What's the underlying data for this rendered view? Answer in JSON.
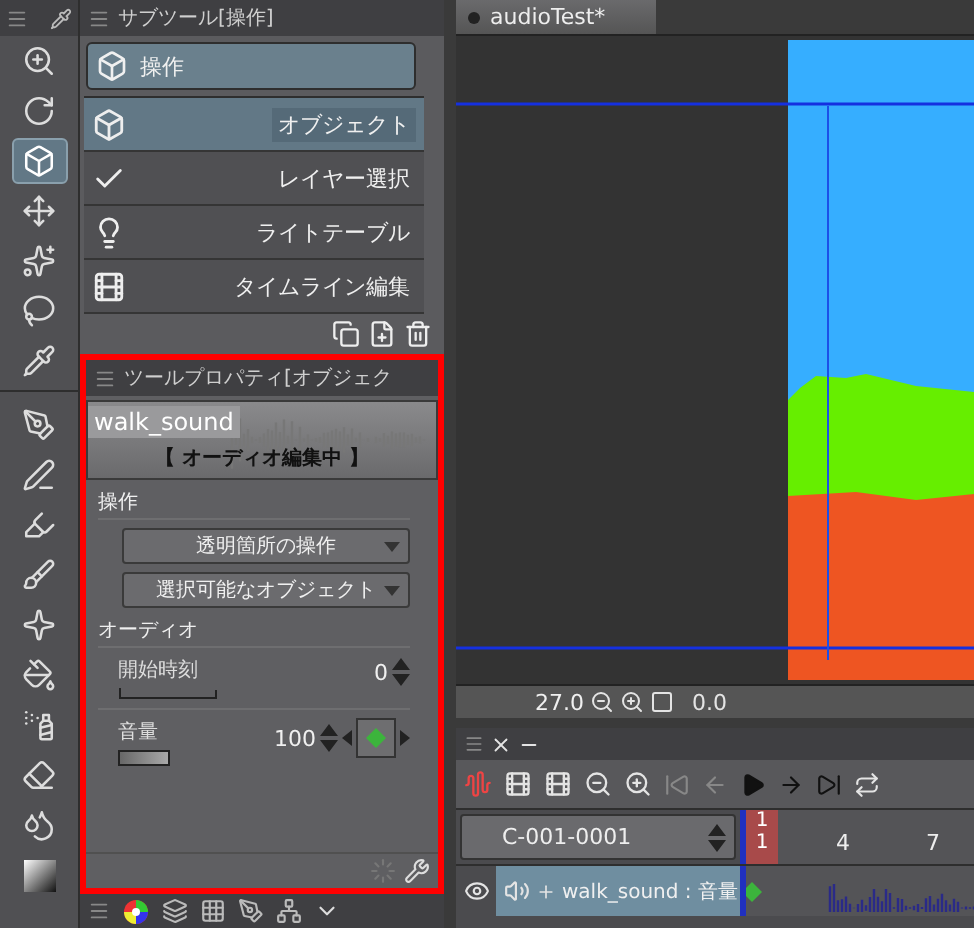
{
  "tool_bar": {
    "groups": [
      {
        "tools": [
          {
            "kind": "zoom",
            "selected": false
          },
          {
            "kind": "rotate",
            "selected": false
          },
          {
            "kind": "operation",
            "selected": true
          },
          {
            "kind": "move",
            "selected": false
          },
          {
            "kind": "wand",
            "selected": false
          },
          {
            "kind": "lasso",
            "selected": false
          },
          {
            "kind": "eyedropper",
            "selected": false
          }
        ]
      },
      {
        "tools": [
          {
            "kind": "pen",
            "selected": false
          },
          {
            "kind": "nib",
            "selected": false
          },
          {
            "kind": "marker",
            "selected": false
          },
          {
            "kind": "brush",
            "selected": false
          },
          {
            "kind": "decoration",
            "selected": false
          },
          {
            "kind": "fill",
            "selected": false
          },
          {
            "kind": "spray",
            "selected": false
          },
          {
            "kind": "eraser",
            "selected": false
          },
          {
            "kind": "blend",
            "selected": false
          },
          {
            "kind": "gradient",
            "selected": false
          }
        ]
      }
    ]
  },
  "sub_tool": {
    "title": "サブツール[操作]",
    "group": {
      "label": "操作",
      "selected": true
    },
    "items": [
      {
        "kind": "object",
        "label": "オブジェクト",
        "selected": true
      },
      {
        "kind": "layer",
        "label": "レイヤー選択",
        "selected": false
      },
      {
        "kind": "light",
        "label": "ライトテーブル",
        "selected": false
      },
      {
        "kind": "timeline",
        "label": "タイムライン編集",
        "selected": false
      }
    ]
  },
  "tool_property": {
    "title": "ツールプロパティ[オブジェク",
    "preview": {
      "name": "walk_sound",
      "status": "【 オーディオ編集中 】"
    },
    "operation_section": {
      "title": "操作",
      "dropdowns": [
        "透明箇所の操作",
        "選択可能なオブジェクト"
      ]
    },
    "audio_section": {
      "title": "オーディオ",
      "start_time": {
        "label": "開始時刻",
        "value": "0"
      },
      "volume": {
        "label": "音量",
        "value": "100"
      }
    }
  },
  "canvas": {
    "tab": "audioTest*",
    "zoom": "27.0",
    "angle": "0.0"
  },
  "timeline": {
    "name": "C-001-0001",
    "ruler": {
      "current": "1",
      "marker": "1",
      "ticks": [
        "4",
        "7"
      ]
    },
    "tracks": [
      {
        "label": "walk_sound : 音量",
        "visible": true
      }
    ]
  }
}
